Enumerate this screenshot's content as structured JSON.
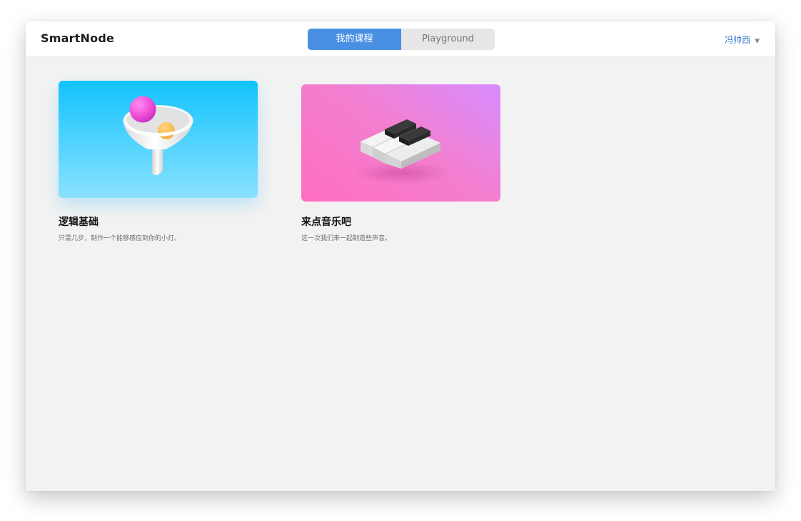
{
  "header": {
    "brand": "SmartNode",
    "tabs": [
      {
        "label": "我的课程",
        "active": true
      },
      {
        "label": "Playground",
        "active": false
      }
    ],
    "user_name": "冯帅西",
    "user_caret": "▼"
  },
  "courses": [
    {
      "title": "逻辑基础",
      "description": "只需几步，制作一个能够感应到你的小灯。",
      "icon": "funnel-icon"
    },
    {
      "title": "来点音乐吧",
      "description": "这一次我们来一起制造些声音。",
      "icon": "piano-keys-icon"
    }
  ],
  "colors": {
    "accent": "#4a90e2",
    "user_link": "#3a7fd1",
    "card1_gradient": [
      "#12c3fd",
      "#8ae2fe"
    ],
    "card2_gradient": [
      "#ff6ec0",
      "#d78cff"
    ]
  }
}
